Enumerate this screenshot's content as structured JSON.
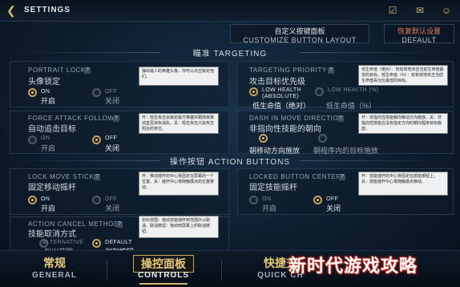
{
  "header": {
    "title": "SETTINGS"
  },
  "top_actions": {
    "customize": {
      "cn": "自定义按键面板",
      "en": "CUSTOMIZE BUTTON LAYOUT"
    },
    "default": {
      "cn": "恢复默认设置",
      "en": "DEFAULT"
    }
  },
  "sections": {
    "targeting": "瞄准 TARGETING",
    "action_buttons": "操作按钮 ACTION BUTTONS"
  },
  "settings": {
    "portrait_lock": {
      "en": "PORTRAIT LOCK",
      "cn": "头像锁定",
      "tip": "弹出敌人的英雄头像，你可以点击锁定他们。",
      "opt1": {
        "en": "ON",
        "cn": "开启"
      },
      "opt2": {
        "en": "OFF",
        "cn": "关闭"
      },
      "selected": "opt1"
    },
    "targeting_priority": {
      "en": "TARGETING PRIORITY",
      "cn": "攻击目标优先级",
      "tip": "低生命值（绝对）：较有效地攻击当前生命值最低的目标。低生命值（%）：较有效地攻击当前生命值百分比最低的目标。",
      "opt1": {
        "en": "LOW HEALTH (ABSOLUTE)",
        "cn": "低生命值（绝对）"
      },
      "opt2": {
        "en": "LOW HEALTH (%)",
        "cn": "低生命值（%）"
      },
      "selected": "opt1"
    },
    "force_attack_follow": {
      "en": "FORCE ATTACK FOLLOW",
      "cn": "自动追击目标",
      "tip": "开：轻击攻击会锁定敌方英雄并跟随其移动直至目标消失。关：轻击攻击只会攻击附近的单位。",
      "opt1": {
        "en": "ON",
        "cn": "开启"
      },
      "opt2": {
        "en": "OFF",
        "cn": "关闭"
      },
      "selected": "opt2"
    },
    "dash_direction": {
      "en": "DASH IN MOVE DIRECTION",
      "cn": "非指向性技能的朝向",
      "tip": "开：非指向性技能朝向移动方向施放。关：非指向性技能在没有指定方向时朝向程序目标施放。",
      "opt1": {
        "en": "",
        "cn": "朝移动方向施放"
      },
      "opt2": {
        "en": "",
        "cn": "朝程序内的目标施放"
      },
      "selected": "opt1"
    },
    "lock_move_stick": {
      "en": "LOCK MOVE STICK",
      "cn": "固定移动摇杆",
      "tip": "开：移动摇杆的中心将固定在屏幕的一个位置。关：摇杆中心将随触摸点的位置移动。",
      "opt1": {
        "en": "ON",
        "cn": "开启"
      },
      "opt2": {
        "en": "OFF",
        "cn": "关闭"
      },
      "selected": "opt1"
    },
    "locked_button_centers": {
      "en": "LOCKED BUTTON CENTERS",
      "cn": "固定技能摇杆",
      "tip": "开：技能摇杆的中心将固定在技能按钮上。关：技能摇杆中心将随触摸点移动。",
      "opt1": {
        "en": "ON",
        "cn": "开启"
      },
      "opt2": {
        "en": "OFF",
        "cn": "关闭"
      },
      "selected": "opt2"
    },
    "action_cancel_method": {
      "en": "ACTION CANCEL METHOD",
      "cn": "技能取消方式",
      "tip": "划出范围：拖动技能摇杆到范围外以取消。取消按钮：拖动到屏幕上的取消按钮。",
      "opt1": {
        "en": "ALTERNATIVE",
        "cn": "划出范围"
      },
      "opt2": {
        "en": "DEFAULT",
        "cn": "划到按钮"
      },
      "selected": "opt2"
    }
  },
  "tabs": [
    {
      "cn": "常规",
      "en": "GENERAL"
    },
    {
      "cn": "操控面板",
      "en": "CONTROLS"
    },
    {
      "cn": "快捷交",
      "en": "QUICK CH"
    }
  ],
  "watermark": "新时代游戏攻略",
  "icons": {
    "back": "back-arrow-icon",
    "tb1": "checklist-icon",
    "tb2": "chat-icon",
    "tb3": "friends-icon"
  },
  "colors": {
    "accent": "#d6b56a",
    "bg": "#0b1624"
  }
}
